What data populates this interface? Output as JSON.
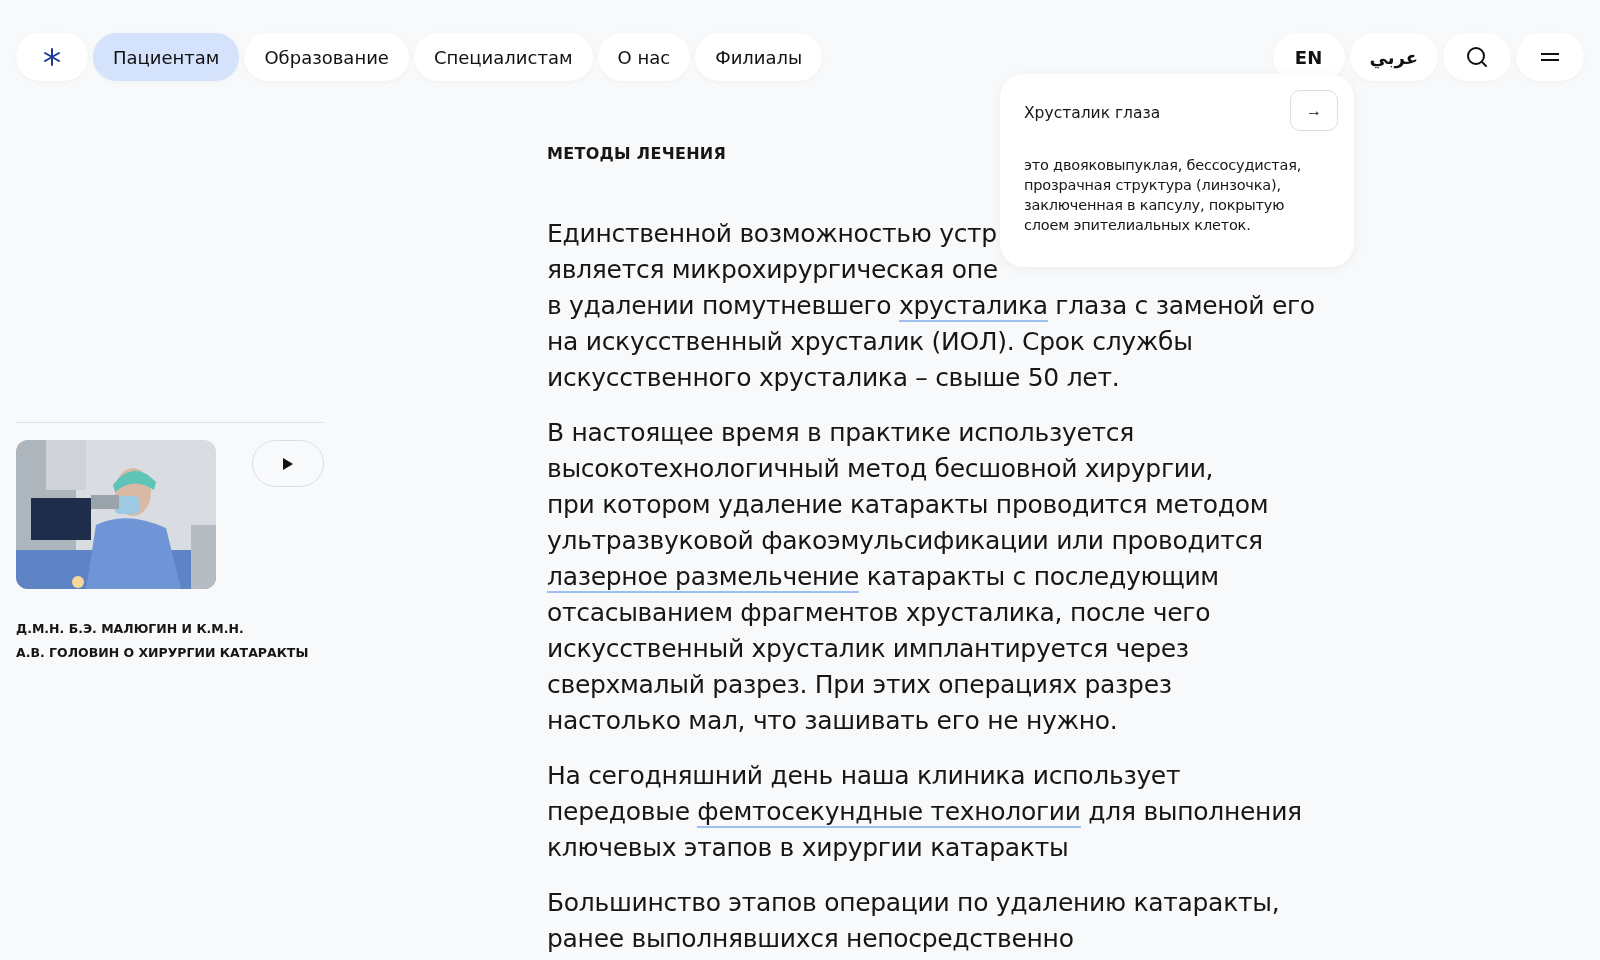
{
  "nav": {
    "items": [
      {
        "label": "Пациентам",
        "selected": true
      },
      {
        "label": "Образование",
        "selected": false
      },
      {
        "label": "Специалистам",
        "selected": false
      },
      {
        "label": "О нас",
        "selected": false
      },
      {
        "label": "Филиалы",
        "selected": false
      }
    ],
    "languages": [
      "EN",
      "عربي"
    ]
  },
  "video": {
    "caption_lines": [
      "Д.М.Н. Б.Э. МАЛЮГИН И К.М.Н.",
      "А.В. ГОЛОВИН О ХИРУРГИИ КАТАРАКТЫ"
    ]
  },
  "article": {
    "section_label": "МЕТОДЫ ЛЕЧЕНИЯ",
    "paragraphs": [
      [
        [
          {
            "text": "Единственной возможностью устр"
          }
        ],
        [
          {
            "text": "является микрохирургическая опе"
          }
        ],
        [
          {
            "text": "в удалении помутневшего "
          },
          {
            "text": "хрусталика",
            "link": true
          },
          {
            "text": " глаза с заменой его"
          }
        ],
        [
          {
            "text": "на искусственный хрусталик (ИОЛ). Срок службы"
          }
        ],
        [
          {
            "text": "искусственного хрусталика – свыше 50 лет."
          }
        ]
      ],
      [
        [
          {
            "text": "В настоящее время в практике используется"
          }
        ],
        [
          {
            "text": "высокотехнологичный метод бесшовной хирургии,"
          }
        ],
        [
          {
            "text": "при котором удаление катаракты проводится методом"
          }
        ],
        [
          {
            "text": "ультразвуковой факоэмульсификации или проводится"
          }
        ],
        [
          {
            "text": "лазерное размельчение",
            "link": true
          },
          {
            "text": " катаракты с последующим"
          }
        ],
        [
          {
            "text": "отсасыванием фрагментов хрусталика, после чего"
          }
        ],
        [
          {
            "text": "искусственный хрусталик имплантируется через"
          }
        ],
        [
          {
            "text": "сверхмалый разрез. При этих операциях разрез"
          }
        ],
        [
          {
            "text": "настолько мал, что зашивать его не нужно."
          }
        ]
      ],
      [
        [
          {
            "text": "На сегодняшний день наша клиника использует"
          }
        ],
        [
          {
            "text": "передовые "
          },
          {
            "text": "фемтосекундные технологии",
            "link": true
          },
          {
            "text": " для выполнения"
          }
        ],
        [
          {
            "text": "ключевых этапов в хирургии катаракты"
          }
        ]
      ],
      [
        [
          {
            "text": "Большинство этапов операции по удалению катаракты,"
          }
        ],
        [
          {
            "text": "ранее выполнявшихся непосредственно"
          }
        ]
      ]
    ]
  },
  "tooltip": {
    "title": "Хрусталик глаза",
    "button": "→",
    "body": "это двояковыпуклая, бессосудистая, прозрачная структура (линзочка), заключенная в капсулу, покрытую слоем эпителиальных клеток."
  }
}
